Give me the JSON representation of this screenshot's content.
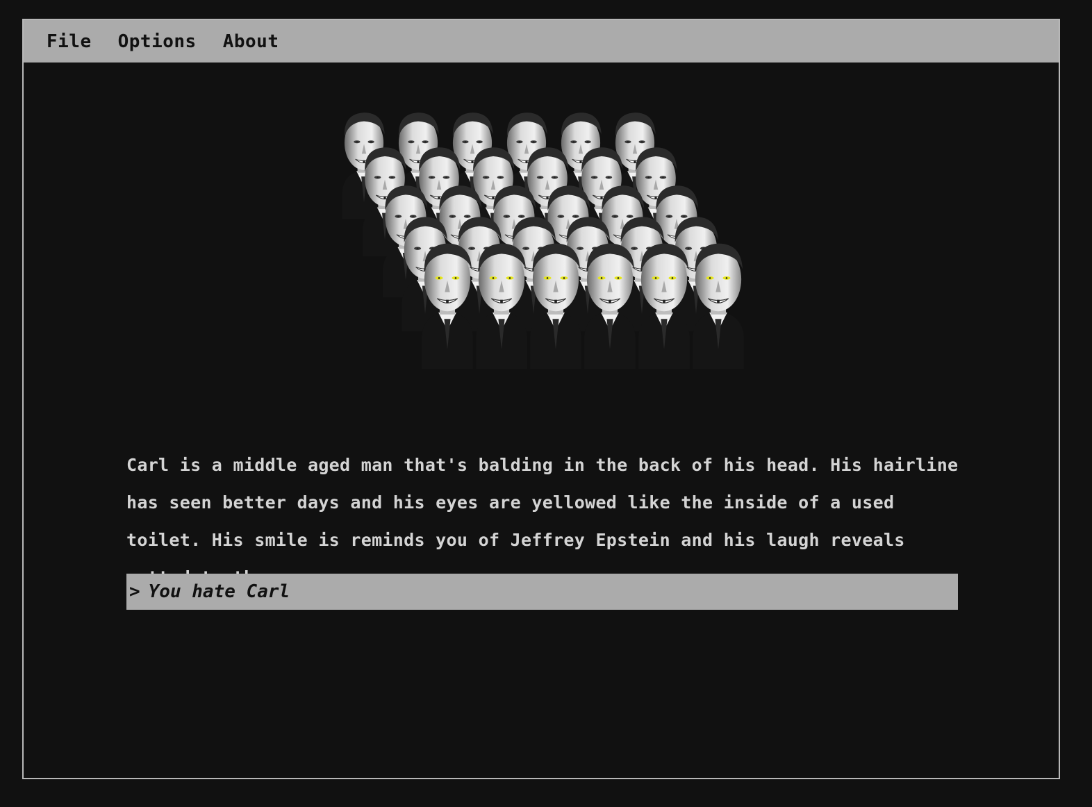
{
  "menu": {
    "items": [
      {
        "label": "File"
      },
      {
        "label": "Options"
      },
      {
        "label": "About"
      }
    ]
  },
  "portrait": {
    "icon": "carl-heads-grid",
    "eye_color": "#e6e619"
  },
  "description": {
    "text": "Carl is a middle aged man that's balding in the back of his head. His hairline has seen better days and his eyes are yellowed like the inside of a used toilet. His smile is reminds you of Jeffrey Epstein and his laugh reveals rotted teeth."
  },
  "choices": [
    {
      "prompt": ">",
      "label": "You hate Carl"
    }
  ],
  "colors": {
    "background": "#111111",
    "menubar": "#ababab",
    "text": "#d4d4d4",
    "choice_bg": "#ababab"
  }
}
